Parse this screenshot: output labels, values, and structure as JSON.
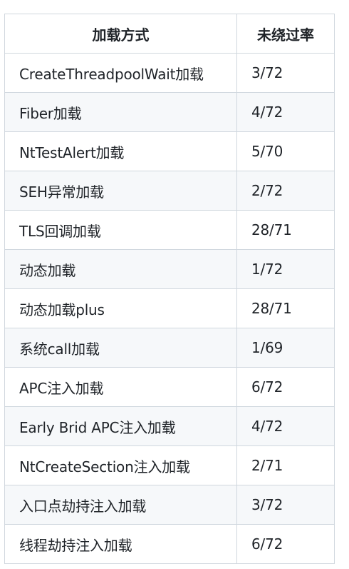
{
  "table": {
    "headers": [
      "加载方式",
      "未绕过率"
    ],
    "rows": [
      [
        "CreateThreadpoolWait加载",
        "3/72"
      ],
      [
        "Fiber加载",
        "4/72"
      ],
      [
        "NtTestAlert加载",
        "5/70"
      ],
      [
        "SEH异常加载",
        "2/72"
      ],
      [
        "TLS回调加载",
        "28/71"
      ],
      [
        "动态加载",
        "1/72"
      ],
      [
        "动态加载plus",
        "28/71"
      ],
      [
        "系统call加载",
        "1/69"
      ],
      [
        "APC注入加载",
        "6/72"
      ],
      [
        "Early Brid APC注入加载",
        "4/72"
      ],
      [
        "NtCreateSection注入加载",
        "2/71"
      ],
      [
        "入口点劫持注入加载",
        "3/72"
      ],
      [
        "线程劫持注入加载",
        "6/72"
      ]
    ]
  }
}
